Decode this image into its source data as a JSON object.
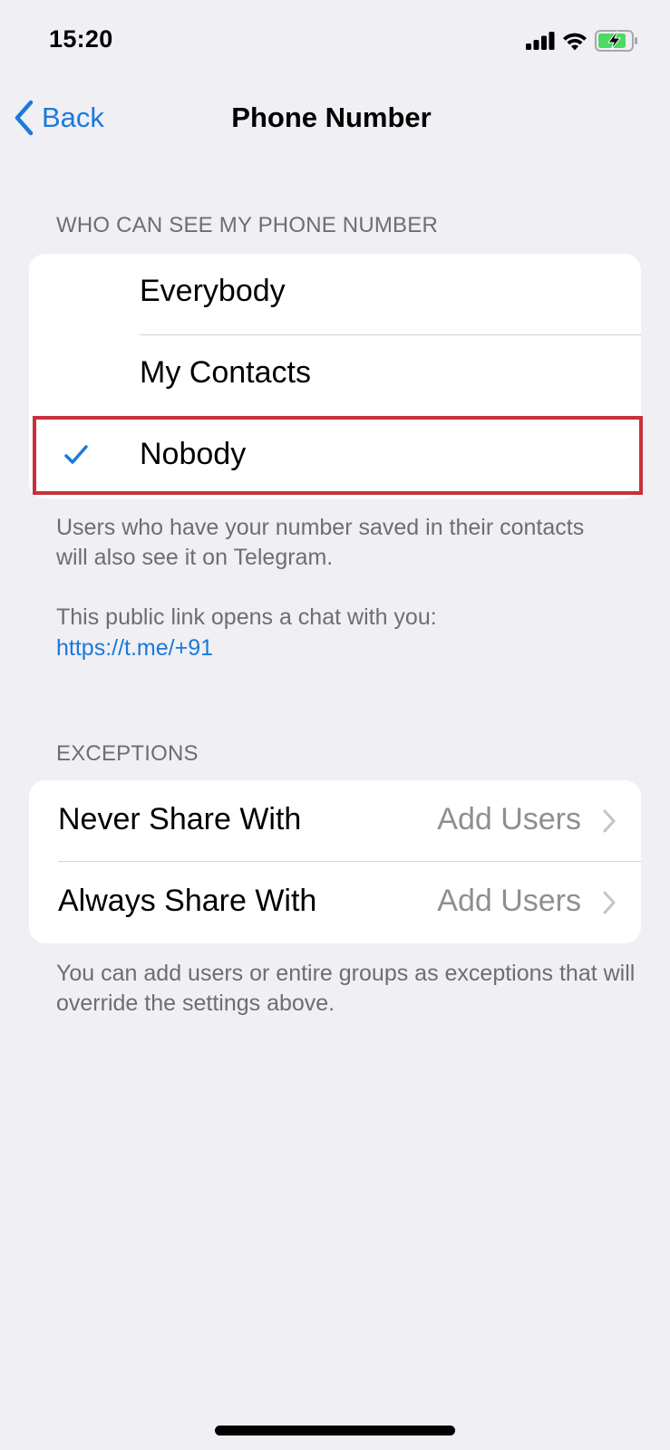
{
  "status_bar": {
    "time": "15:20",
    "icons": [
      "cellular-signal-icon",
      "wifi-icon",
      "battery-charging-icon"
    ],
    "battery_color": "#4cd964"
  },
  "nav": {
    "back_label": "Back",
    "title": "Phone Number"
  },
  "visibility_section": {
    "header": "WHO CAN SEE MY PHONE NUMBER",
    "options": [
      {
        "label": "Everybody",
        "selected": false
      },
      {
        "label": "My Contacts",
        "selected": false
      },
      {
        "label": "Nobody",
        "selected": true
      }
    ],
    "footer_line1": "Users who have your number saved in their contacts will also see it on Telegram.",
    "footer_line2": "This public link opens a chat with you:",
    "link": "https://t.me/+91"
  },
  "exceptions_section": {
    "header": "EXCEPTIONS",
    "rows": [
      {
        "label": "Never Share With",
        "value": "Add Users"
      },
      {
        "label": "Always Share With",
        "value": "Add Users"
      }
    ],
    "footer": "You can add users or entire groups as exceptions that will override the settings above."
  },
  "colors": {
    "accent": "#1a7ad9",
    "background": "#efeff4",
    "secondary_text": "#6d6d72",
    "highlight_annotation": "#c8303a"
  }
}
